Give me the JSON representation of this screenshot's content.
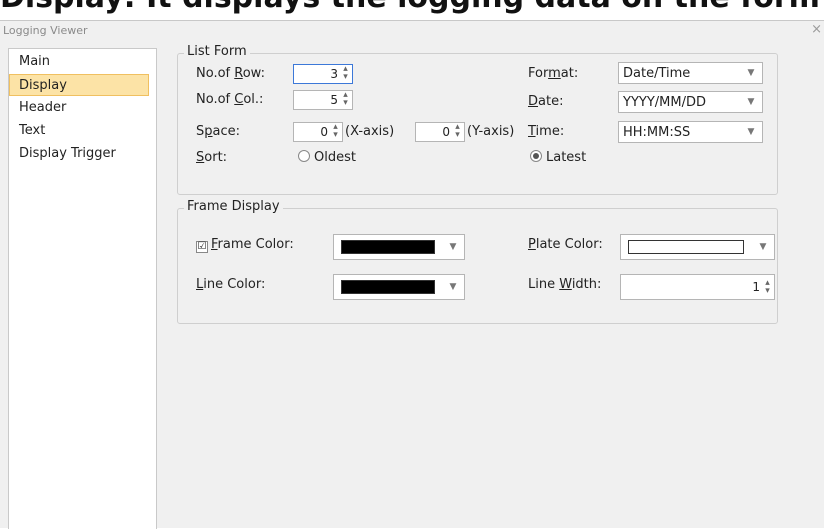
{
  "bg_heading": "Display: It displays the logging data on the form of",
  "window": {
    "title": "Logging Viewer",
    "close_glyph": "×"
  },
  "sidebar": {
    "items": [
      {
        "label": "Main"
      },
      {
        "label": "Display",
        "selected": true
      },
      {
        "label": "Header"
      },
      {
        "label": "Text"
      },
      {
        "label": "Display Trigger"
      }
    ]
  },
  "list_form": {
    "title": "List Form",
    "rows_label_pre": "No.of ",
    "rows_label_ul": "R",
    "rows_label_post": "ow:",
    "rows_value": "3",
    "cols_label_pre": "No.of ",
    "cols_label_ul": "C",
    "cols_label_post": "ol.:",
    "cols_value": "5",
    "space_label_pre": "S",
    "space_label_ul": "p",
    "space_label_post": "ace:",
    "space_x_value": "0",
    "space_x_suffix": "(X-axis)",
    "space_y_value": "0",
    "space_y_suffix": "(Y-axis)",
    "sort_label_ul": "S",
    "sort_label_post": "ort:",
    "sort_oldest": "Oldest",
    "sort_latest": "Latest",
    "sort_selected": "Latest",
    "format_label_pre": "For",
    "format_label_ul": "m",
    "format_label_post": "at:",
    "format_value": "Date/Time",
    "date_label_ul": "D",
    "date_label_post": "ate:",
    "date_value": "YYYY/MM/DD",
    "time_label_ul": "T",
    "time_label_post": "ime:",
    "time_value": "HH:MM:SS"
  },
  "frame_display": {
    "title": "Frame Display",
    "frame_color_check": "☑",
    "frame_color_label_ul": "F",
    "frame_color_label_post": "rame Color:",
    "frame_color_checked": true,
    "frame_color": "#000000",
    "line_color_label_ul": "L",
    "line_color_label_post": "ine Color:",
    "line_color": "#000000",
    "plate_color_label_ul": "P",
    "plate_color_label_post": "late Color:",
    "plate_color": "#ffffff",
    "line_width_label_pre": "Line ",
    "line_width_label_ul": "W",
    "line_width_label_post": "idth:",
    "line_width_value": "1"
  },
  "icons": {
    "spin": "spin-arrows-icon",
    "dropdown": "chevron-down-icon",
    "close": "close-icon"
  },
  "colors": {
    "selected_bg": "#fce3a6",
    "focus_border": "#3c78d8"
  }
}
